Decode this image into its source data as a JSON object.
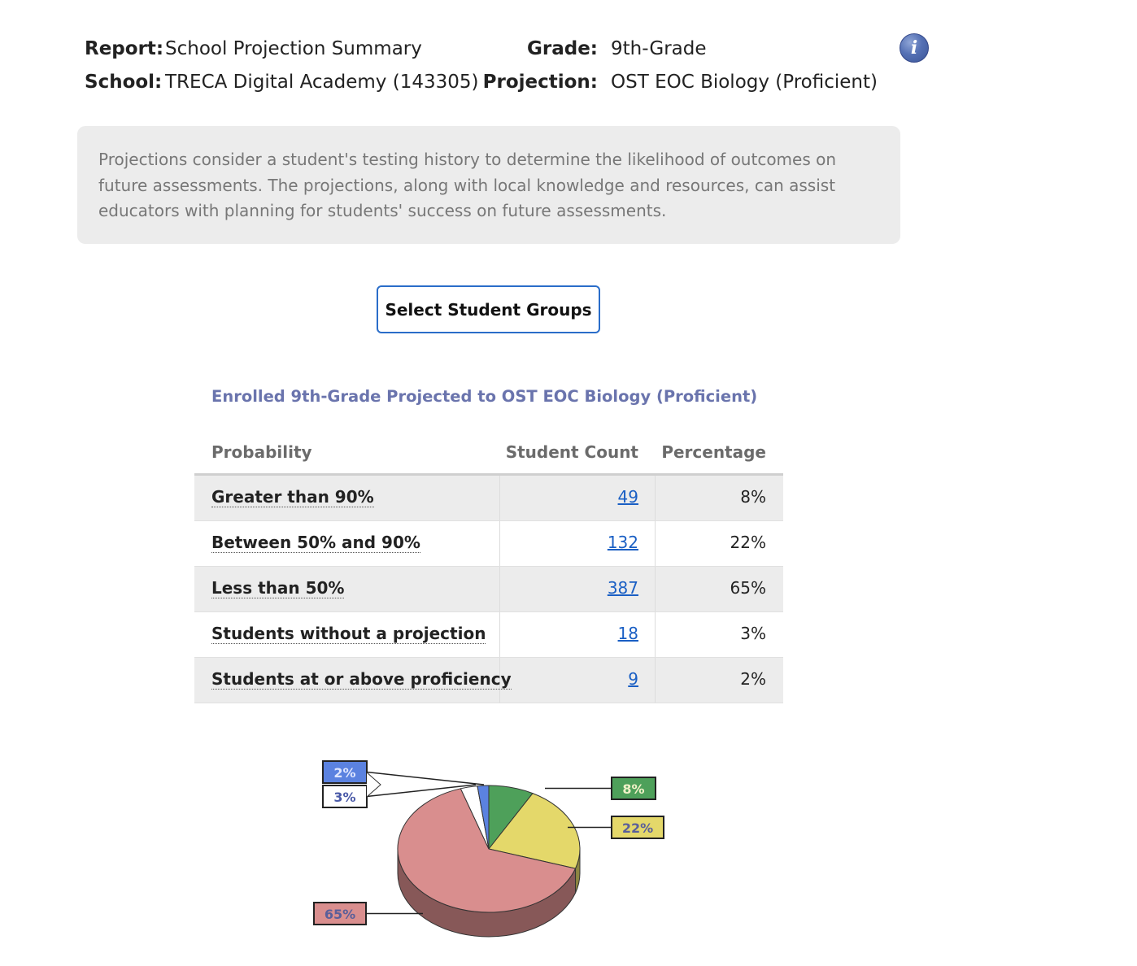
{
  "header": {
    "report_label": "Report:",
    "report_value": "School Projection Summary",
    "school_label": "School:",
    "school_value": "TRECA Digital Academy (143305)",
    "grade_label": "Grade:",
    "grade_value": "9th-Grade",
    "projection_label": "Projection:",
    "projection_value": "OST EOC Biology (Proficient)",
    "info_icon": "i"
  },
  "description": "Projections consider a student's testing history to determine the likelihood of outcomes on future assessments. The projections, along with local knowledge and resources, can assist educators with planning for students' success on future assessments.",
  "select_button": "Select Student Groups",
  "table": {
    "title": "Enrolled 9th-Grade Projected to OST EOC Biology (Proficient)",
    "headers": [
      "Probability",
      "Student Count",
      "Percentage"
    ],
    "rows": [
      {
        "probability": "Greater than 90%",
        "count": "49",
        "percentage": "8%"
      },
      {
        "probability": "Between 50% and 90%",
        "count": "132",
        "percentage": "22%"
      },
      {
        "probability": "Less than 50%",
        "count": "387",
        "percentage": "65%"
      },
      {
        "probability": "Students without a projection",
        "count": "18",
        "percentage": "3%"
      },
      {
        "probability": "Students at or above proficiency",
        "count": "9",
        "percentage": "2%"
      }
    ]
  },
  "chart_data": {
    "type": "pie",
    "title": "",
    "slices": [
      {
        "label": "8%",
        "value": 8,
        "color": "#4ea05a"
      },
      {
        "label": "22%",
        "value": 22,
        "color": "#e4d86a"
      },
      {
        "label": "65%",
        "value": 65,
        "color": "#d98e8e"
      },
      {
        "label": "3%",
        "value": 3,
        "color": "#ffffff"
      },
      {
        "label": "2%",
        "value": 2,
        "color": "#5b82e0"
      }
    ]
  }
}
